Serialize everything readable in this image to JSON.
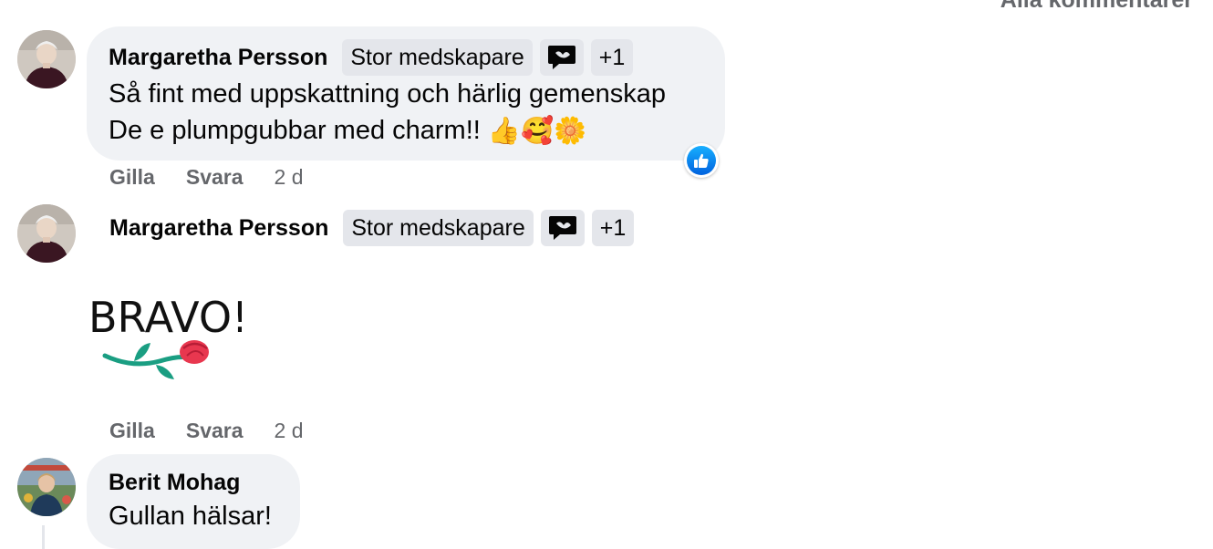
{
  "header": {
    "all_comments_label": "Alla kommentarer"
  },
  "comments": [
    {
      "author": "Margaretha Persson",
      "badge": "Stor medskapare",
      "badge_icon": "chat-bubble-icon",
      "badge_more": "+1",
      "lines": [
        "Så fint med uppskattning och härlig gemenskap",
        "De e plumpgubbar med charm!!"
      ],
      "emojis": [
        "👍",
        "🥰",
        "🌼"
      ],
      "reaction": "like-icon",
      "actions": {
        "like": "Gilla",
        "reply": "Svara",
        "time": "2 d"
      }
    },
    {
      "author": "Margaretha Persson",
      "badge": "Stor medskapare",
      "badge_icon": "chat-bubble-icon",
      "badge_more": "+1",
      "sticker_text": "BRAVO!",
      "actions": {
        "like": "Gilla",
        "reply": "Svara",
        "time": "2 d"
      }
    },
    {
      "author": "Berit Mohag",
      "lines": [
        "Gullan hälsar!"
      ]
    }
  ],
  "colors": {
    "bubble": "#f0f2f5",
    "badge": "#e4e6eb",
    "muted_text": "#65676b",
    "like_blue": "#0866ff",
    "rose_red": "#e8374f",
    "stem_green": "#1a9e82"
  }
}
